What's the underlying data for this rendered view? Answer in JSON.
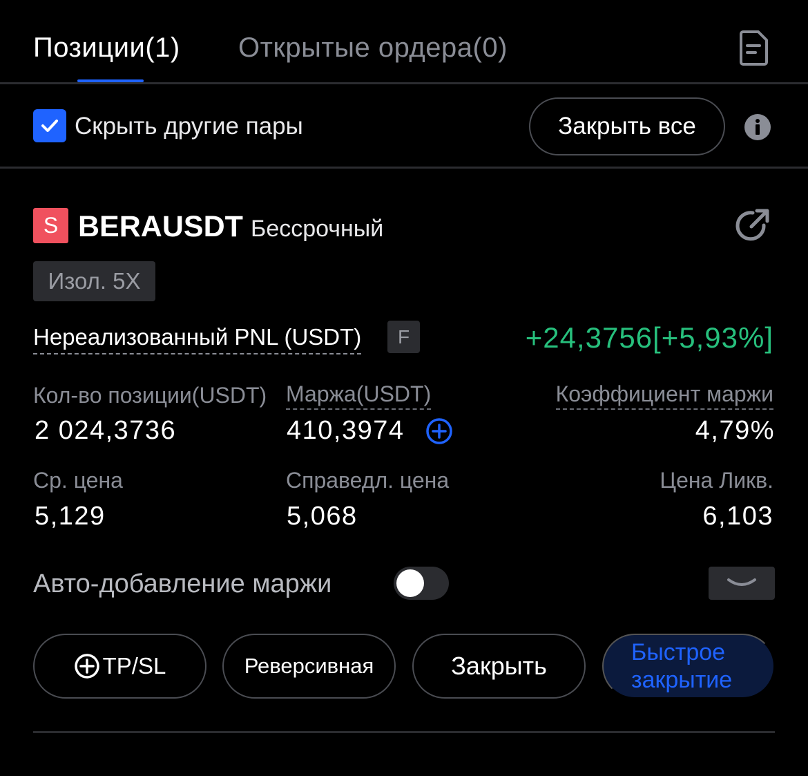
{
  "tabs": [
    {
      "label": "Позиции(1)",
      "active": true
    },
    {
      "label": "Открытые ордера(0)",
      "active": false
    }
  ],
  "filter": {
    "hide_other_pairs_label": "Скрыть другие пары",
    "hide_other_pairs_checked": true,
    "close_all_label": "Закрыть все"
  },
  "position": {
    "side_badge": "S",
    "symbol": "BERAUSDT",
    "contract_type": "Бессрочный",
    "leverage": "Изол. 5X",
    "pnl_label": "Нереализованный PNL (USDT)",
    "pnl_chip": "F",
    "pnl_value": "+24,3756[+5,93%]",
    "size_label": "Кол-во позиции(USDT)",
    "size_value": "2 024,3736",
    "margin_label": "Маржа(USDT)",
    "margin_value": "410,3974",
    "margin_ratio_label": "Коэффициент маржи",
    "margin_ratio_value": "4,79%",
    "avg_price_label": "Ср. цена",
    "avg_price_value": "5,129",
    "fair_price_label": "Справедл. цена",
    "fair_price_value": "5,068",
    "liq_price_label": "Цена Ликв.",
    "liq_price_value": "6,103",
    "auto_margin_label": "Авто-добавление маржи",
    "auto_margin_enabled": false
  },
  "actions": {
    "tpsl_label": "TP/SL",
    "reverse_label": "Реверсивная",
    "close_label": "Закрыть",
    "quick_close_label": "Быстрое закрытие"
  },
  "colors": {
    "accent": "#1f63ff",
    "profit": "#27c07d",
    "short": "#f0515e"
  }
}
